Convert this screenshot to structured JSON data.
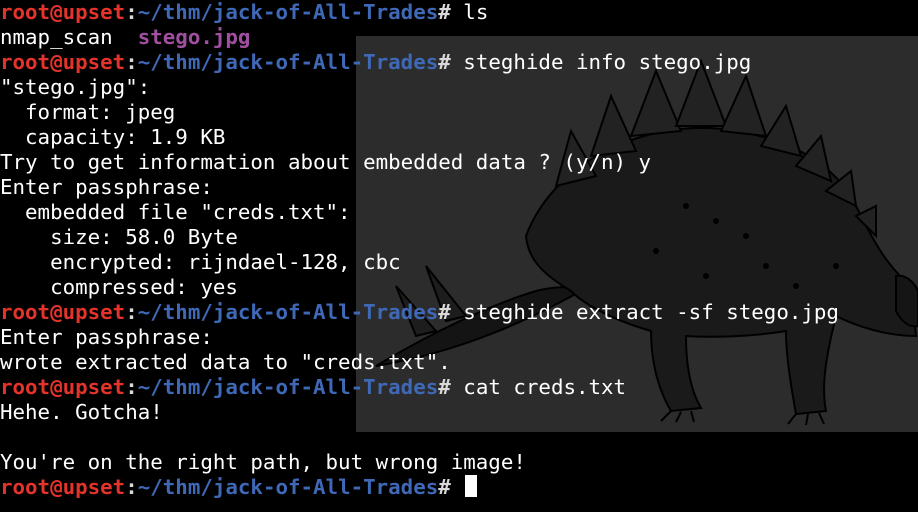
{
  "prompt": {
    "user_host": "root@upset",
    "separator": ":",
    "path": "~/thm/jack-of-All-Trades",
    "symbol": "# "
  },
  "commands": {
    "ls": "ls",
    "info": "steghide info stego.jpg",
    "extract": "steghide extract -sf stego.jpg",
    "cat": "cat creds.txt"
  },
  "ls_output": {
    "file1": "nmap_scan",
    "gap": "  ",
    "file2": "stego.jpg"
  },
  "info_output": [
    "\"stego.jpg\":",
    "  format: jpeg",
    "  capacity: 1.9 KB",
    "Try to get information about embedded data ? (y/n) y",
    "Enter passphrase:",
    "  embedded file \"creds.txt\":",
    "    size: 58.0 Byte",
    "    encrypted: rijndael-128, cbc",
    "    compressed: yes"
  ],
  "extract_output": [
    "Enter passphrase:",
    "wrote extracted data to \"creds.txt\"."
  ],
  "cat_output": [
    "Hehe. Gotcha!",
    "",
    "You're on the right path, but wrong image!"
  ],
  "image_viewer": {
    "subject_icon": "stegosaurus-illustration"
  },
  "colors": {
    "background": "#000000",
    "user_host": "#e4332b",
    "path": "#3f69b6",
    "image_file": "#a04fa0",
    "text": "#ffffff",
    "image_bg": "#2c2c2c"
  }
}
